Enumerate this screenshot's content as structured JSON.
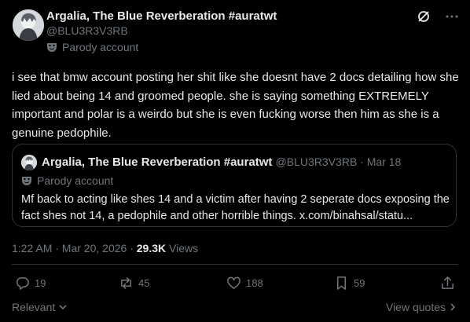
{
  "author": {
    "display_name": "Argalia, The Blue Reverberation #auratwt",
    "handle": "@BLU3R3V3RB",
    "parody_label": "Parody account",
    "avatar_icon": "avatar-image"
  },
  "post": {
    "text": "i see that bmw account posting her shit like she doesnt have 2 docs detailing how she lied about being 14 and groomed people. she is saying something EXTREMELY important and polar is a weirdo but she is even fucking worse then him as she is a genuine pedophile."
  },
  "quoted": {
    "display_name": "Argalia, The Blue Reverberation #auratwt",
    "handle_date": "@BLU3R3V3RB · Mar 18",
    "parody_label": "Parody account",
    "text": "Mf back to acting like shes 14 and a victim after having 2 seperate docs exposing the fact shes not 14, a pedophile and other horrible things. x.com/binahsal/statu..."
  },
  "meta": {
    "timestamp": "1:22 AM · Mar 20, 2026 · ",
    "views_count": "29.3K",
    "views_label": " Views"
  },
  "actions": {
    "replies": "19",
    "reposts": "45",
    "likes": "188",
    "bookmarks": "59"
  },
  "footer": {
    "relevant": "Relevant",
    "view_quotes": "View quotes"
  },
  "colors": {
    "background": "#000000",
    "text": "#e7e9ea",
    "secondary": "#71767b",
    "border": "#2f3336"
  }
}
